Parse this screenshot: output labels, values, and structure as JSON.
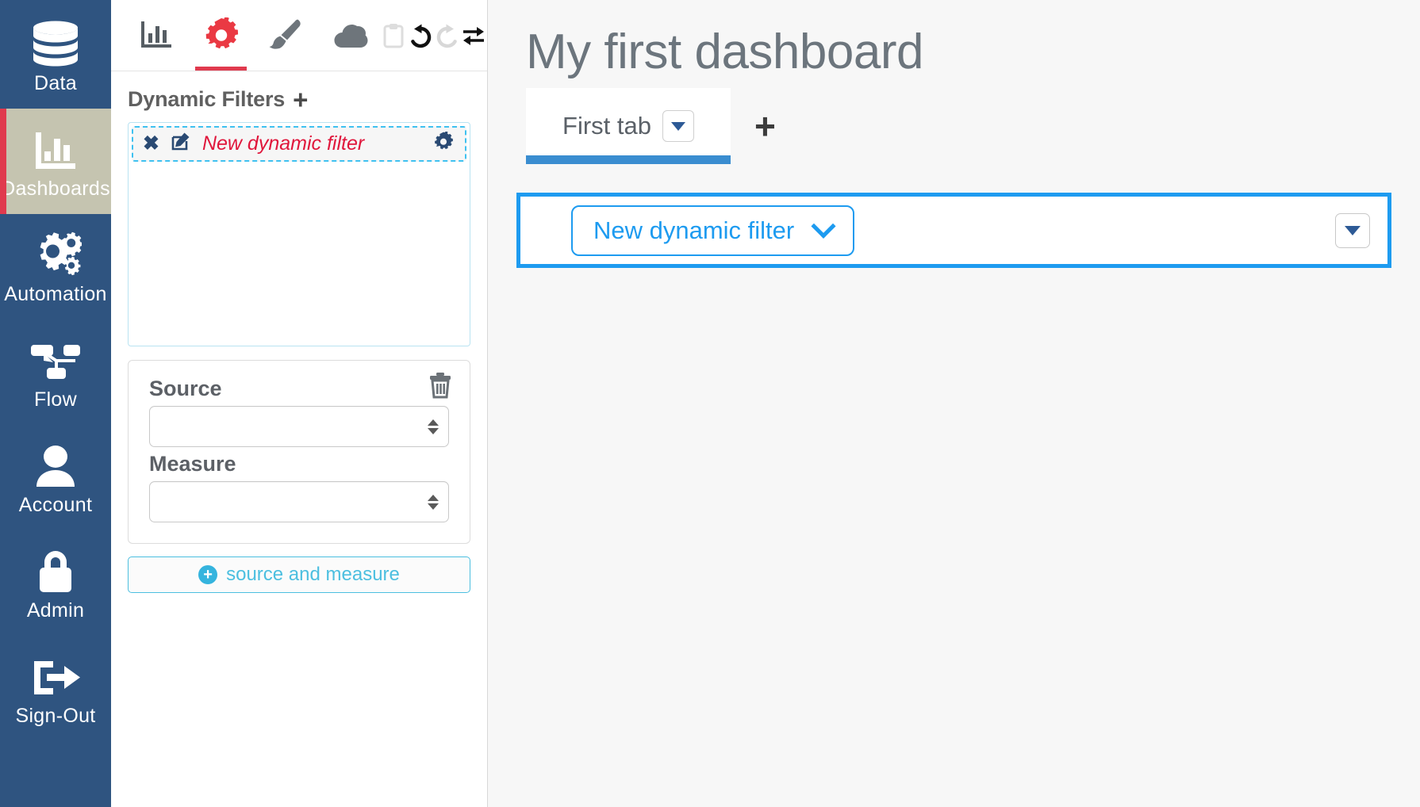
{
  "nav": {
    "items": [
      {
        "label": "Data",
        "icon": "database-icon",
        "active": false
      },
      {
        "label": "Dashboards",
        "icon": "bar-chart-icon",
        "active": true
      },
      {
        "label": "Automation",
        "icon": "gears-icon",
        "active": false
      },
      {
        "label": "Flow",
        "icon": "sitemap-icon",
        "active": false
      },
      {
        "label": "Account",
        "icon": "user-icon",
        "active": false
      },
      {
        "label": "Admin",
        "icon": "lock-icon",
        "active": false
      },
      {
        "label": "Sign-Out",
        "icon": "sign-out-icon",
        "active": false
      }
    ]
  },
  "panel": {
    "toolbar": {
      "tools": [
        {
          "name": "chart-icon",
          "title": "Charts",
          "active": false
        },
        {
          "name": "gear-icon",
          "title": "Settings",
          "active": true
        },
        {
          "name": "paintbrush-icon",
          "title": "Style",
          "active": false
        },
        {
          "name": "cloud-icon",
          "title": "Cloud",
          "active": false
        },
        {
          "name": "clipboard-icon",
          "title": "Clipboard",
          "active": false
        },
        {
          "name": "undo-icon",
          "title": "Undo",
          "active": false
        },
        {
          "name": "redo-icon",
          "title": "Redo",
          "active": false
        },
        {
          "name": "swap-icon",
          "title": "Swap",
          "active": false
        }
      ]
    },
    "filters": {
      "section_title": "Dynamic Filters",
      "add_glyph": "+",
      "items": [
        {
          "close_glyph": "✖",
          "name": "New dynamic filter",
          "edit_icon": "edit-square-icon",
          "settings_icon": "gear-icon"
        }
      ]
    },
    "source_measure": {
      "trash_icon": "trash-icon",
      "source_label": "Source",
      "source_value": "",
      "measure_label": "Measure",
      "measure_value": "",
      "add_button_label": "source and measure",
      "add_button_glyph": "+"
    }
  },
  "main": {
    "title": "My first dashboard",
    "tabs": [
      {
        "label": "First tab",
        "active": true,
        "caret_icon": "caret-down-icon"
      }
    ],
    "add_tab_glyph": "+",
    "widget": {
      "filter_label": "New dynamic filter",
      "filter_chevron_icon": "chevron-down-icon",
      "menu_caret_icon": "caret-down-icon"
    }
  },
  "colors": {
    "nav_bg": "#2f5480",
    "nav_active_bg": "#c5c4b0",
    "accent_red": "#e03a4e",
    "filter_red": "#e0173c",
    "cyan": "#3fc1f0",
    "blue": "#1d9bf0",
    "tab_underline": "#3a8dd0"
  }
}
